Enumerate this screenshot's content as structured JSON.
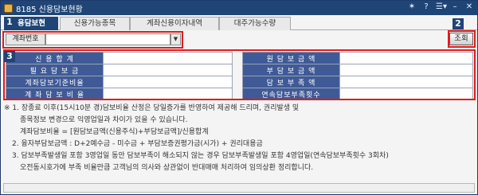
{
  "window": {
    "title": "8185 신용담보현황"
  },
  "title_tools": {
    "pin": "✶",
    "help": "?",
    "menu": "☰▾",
    "minimize": "–",
    "close": "✕"
  },
  "tabs": [
    {
      "label": "용담보현황"
    },
    {
      "label": "신용가능종목"
    },
    {
      "label": "계좌신용이자내역"
    },
    {
      "label": "대주가능수량"
    }
  ],
  "badges": {
    "b1": "1",
    "b2": "2",
    "b3": "3"
  },
  "account": {
    "label": "계좌번호",
    "value": "",
    "dropdown_icon": "▼"
  },
  "query_button": {
    "label": "조회"
  },
  "left_rows": [
    {
      "label": "신 용 합 계",
      "value": ""
    },
    {
      "label": "필 요 담 보 금",
      "value": ""
    },
    {
      "label": "계좌담보기준비율",
      "value": ""
    },
    {
      "label": "계 좌 담 보 비 율",
      "value": ""
    }
  ],
  "right_rows": [
    {
      "label": "원 담 보 금 액",
      "value": ""
    },
    {
      "label": "부 담 보 금 액",
      "value": ""
    },
    {
      "label": "담 보 부 족 액",
      "value": ""
    },
    {
      "label": "연속담보부족횟수",
      "value": ""
    }
  ],
  "notes": [
    "※ 1. 장종료 이후(15시10분 경)담보비율 산정은 당일증가를 반영하여 제공해 드리며, 권리발생 및",
    "종목정보 변경으로 익영업일과 차이가 있을 수 있습니다.",
    "계좌담보비율 = [원담보금액(신용주식)+부담보금액]/신용합계",
    "2. 융자부담보금액 : D+2예수금 - 미수금 + 부담보증권평가금(시가) + 권리대용금",
    "3. 담보부족발생일 포함 3영업일 동안 담보부족이 해소되지 않는 경우 담보부족발생일 포함 4영업일(연속담보부족횟수 3회차)",
    "오전동시호가에 부족 비율만큼 고객님의 의사와 상관없이 반대매매 처리하여 임의상환 정리합니다."
  ],
  "colors": {
    "title_bar": "#1f4577",
    "label_cell": "#3f5a96",
    "highlight": "#e31b1b"
  }
}
